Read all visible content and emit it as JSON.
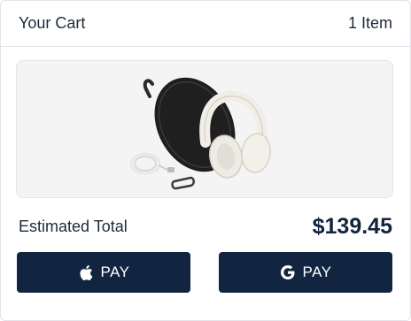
{
  "cart": {
    "title": "Your Cart",
    "item_count": "1 Item"
  },
  "product": {
    "image_icon": "headphones-with-case-icon"
  },
  "summary": {
    "total_label": "Estimated Total",
    "total_value": "$139.45"
  },
  "payments": {
    "apple_pay_label": "PAY",
    "apple_icon": "apple-icon",
    "google_pay_label": "PAY",
    "google_icon": "google-g-icon"
  },
  "colors": {
    "button_bg": "#112540",
    "text": "#1e2a3a",
    "border": "#e2e4e8"
  }
}
